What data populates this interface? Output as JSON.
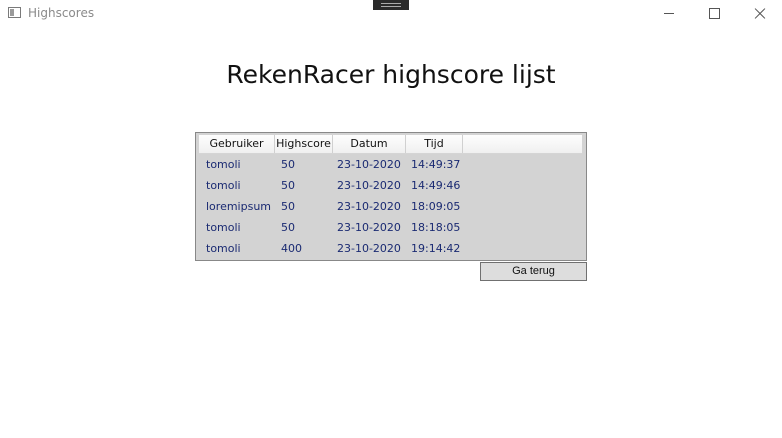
{
  "window": {
    "title": "Highscores"
  },
  "page_title": "RekenRacer highscore lijst",
  "grid": {
    "columns": [
      "Gebruiker",
      "Highscore",
      "Datum",
      "Tijd"
    ],
    "rows": [
      [
        "tomoli",
        "50",
        "23-10-2020",
        "14:49:37"
      ],
      [
        "tomoli",
        "50",
        "23-10-2020",
        "14:49:46"
      ],
      [
        "loremipsum",
        "50",
        "23-10-2020",
        "18:09:05"
      ],
      [
        "tomoli",
        "50",
        "23-10-2020",
        "18:18:05"
      ],
      [
        "tomoli",
        "400",
        "23-10-2020",
        "19:14:42"
      ]
    ]
  },
  "back_button": "Ga terug",
  "colors": {
    "grid_background": "#d3d3d3",
    "cell_text": "#1a2a72"
  }
}
